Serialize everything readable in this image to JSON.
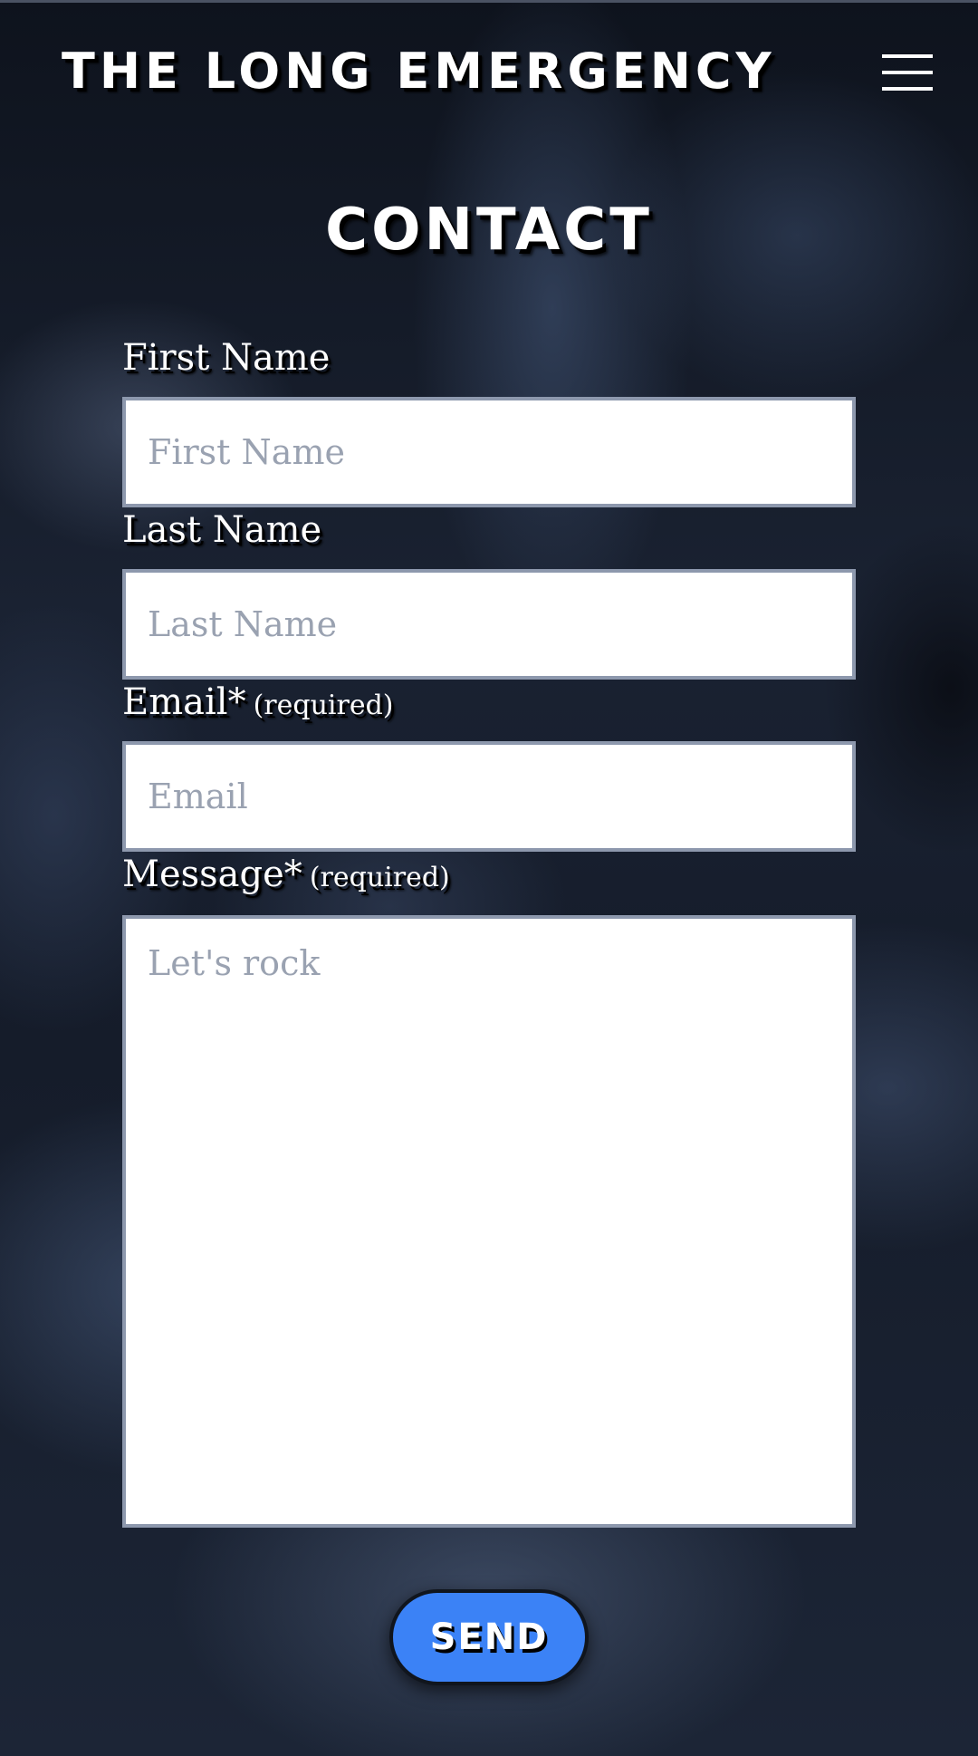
{
  "site": {
    "title": "THE LONG EMERGENCY",
    "menu_icon": "hamburger-menu-icon"
  },
  "page": {
    "title": "CONTACT"
  },
  "form": {
    "first_name": {
      "label": "First Name",
      "placeholder": "First Name",
      "value": ""
    },
    "last_name": {
      "label": "Last Name",
      "placeholder": "Last Name",
      "value": ""
    },
    "email": {
      "label": "Email*",
      "required_note": "(required)",
      "placeholder": "Email",
      "value": ""
    },
    "message": {
      "label": "Message*",
      "required_note": "(required)",
      "placeholder": "Let's rock",
      "value": ""
    },
    "submit_label": "SEND"
  },
  "colors": {
    "button_blue": "#3b82f6",
    "input_border": "#8d98ad",
    "placeholder": "#9aa2b1",
    "text": "#ffffff"
  }
}
